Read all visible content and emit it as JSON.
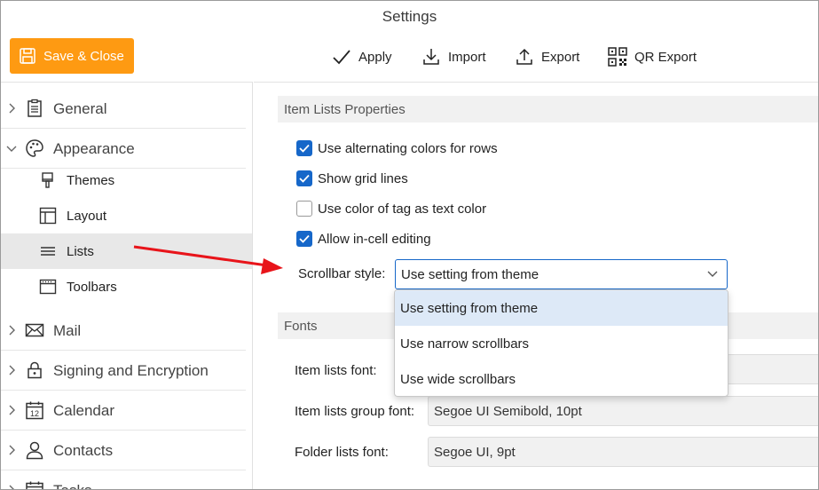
{
  "window": {
    "title": "Settings"
  },
  "actions": {
    "save_close": "Save & Close",
    "apply": "Apply",
    "import": "Import",
    "export": "Export",
    "qr_export": "QR Export"
  },
  "sidebar": {
    "general": "General",
    "appearance": "Appearance",
    "themes": "Themes",
    "layout": "Layout",
    "lists": "Lists",
    "toolbars": "Toolbars",
    "mail": "Mail",
    "signing": "Signing and Encryption",
    "calendar": "Calendar",
    "calendar_icon_day": "12",
    "contacts": "Contacts",
    "tasks": "Tasks"
  },
  "item_lists": {
    "header": "Item Lists Properties",
    "options": [
      {
        "label": "Use alternating colors for rows",
        "checked": true
      },
      {
        "label": "Show grid lines",
        "checked": true
      },
      {
        "label": "Use color of tag as text color",
        "checked": false
      },
      {
        "label": "Allow in-cell editing",
        "checked": true
      }
    ],
    "scrollbar_label": "Scrollbar style:",
    "scrollbar_value": "Use setting from theme",
    "scrollbar_options": [
      "Use setting from theme",
      "Use narrow scrollbars",
      "Use wide scrollbars"
    ]
  },
  "fonts": {
    "header": "Fonts",
    "item_lists_font_label": "Item lists font:",
    "item_lists_group_font_label": "Item lists group font:",
    "item_lists_group_font_value": "Segoe UI Semibold, 10pt",
    "folder_lists_font_label": "Folder lists font:",
    "folder_lists_font_value": "Segoe UI, 9pt"
  },
  "colors": {
    "accent": "#1667c9",
    "save_button": "#fe9a12",
    "annotation_arrow": "#e8141a"
  }
}
